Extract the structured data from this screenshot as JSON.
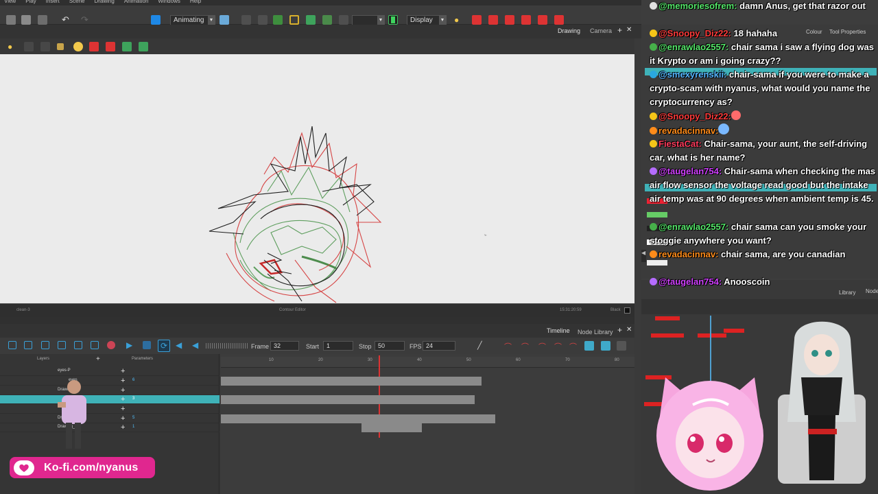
{
  "menu": [
    "View",
    "Play",
    "Insert",
    "Scene",
    "Drawing",
    "Animation",
    "Windows",
    "Help"
  ],
  "toolbar": {
    "mode": "Animating",
    "display": "Display"
  },
  "viewport": {
    "tabs": [
      "Drawing",
      "Camera"
    ],
    "status_left": "clean-3",
    "status_center": "Contour Editor",
    "status_right_a": "15:31:20:59",
    "status_right_b": "Black"
  },
  "timeline": {
    "tabs": [
      "Timeline",
      "Node Library"
    ],
    "frame_label": "Frame",
    "frame_value": "32",
    "start_label": "Start",
    "start_value": "1",
    "stop_label": "Stop",
    "stop_value": "50",
    "fps_label": "FPS",
    "fps_value": "24",
    "layers_header": "Layers",
    "params_header": "Parameters",
    "ruler": [
      "10",
      "20",
      "30",
      "40",
      "50",
      "60",
      "70",
      "80"
    ],
    "layers": [
      {
        "name": "eyes-P",
        "num": ""
      },
      {
        "name": "eyes",
        "num": "6"
      },
      {
        "name": "Drawing",
        "num": ""
      },
      {
        "name": "",
        "num": "3"
      },
      {
        "name": "",
        "num": ""
      },
      {
        "name": "Drawing_2",
        "num": "5"
      },
      {
        "name": "Drawing_3",
        "num": "1"
      }
    ]
  },
  "kofi": {
    "text": "Ko-fi.com/nyanus"
  },
  "chat": [
    {
      "user": "@memoriesofrem:",
      "text": " damn Anus, get that razor out",
      "color": "#55e86a"
    },
    {
      "user": "@Snoopy_Diz22:",
      "text": " 18 hahaha",
      "color": "#ff3b3b"
    },
    {
      "user": "@enrawlao2557:",
      "text": " chair sama i saw a flying dog was it Krypto or am i going crazy??",
      "color": "#55e86a"
    },
    {
      "user": "@smexyrenskii:",
      "text": " chair-sama if you were to make a crypto-scam with nyanus, what would you name the cryptocurrency as?",
      "color": "#55b4ff"
    },
    {
      "user": "@Snoopy_Diz22:",
      "text": "",
      "color": "#ff3b3b"
    },
    {
      "user": "revadacinnav:",
      "text": "",
      "color": "#ff8c1a"
    },
    {
      "user": "FiestaCat:",
      "text": " Chair-sama, your aunt, the self-driving car, what is her name?",
      "color": "#ff3b5c"
    },
    {
      "user": "@taugelan754:",
      "text": " Chair-sama when checking the mas air flow sensor the voltage read good but the intake air temp was at 90 degrees when ambient temp is 45.",
      "color": "#d040ff"
    },
    {
      "user": "@enrawlao2557:",
      "text": " chair sama can you smoke your stoggie anywhere you want?",
      "color": "#55e86a"
    },
    {
      "user": "revadacinnav:",
      "text": " chair sama, are you canadian",
      "color": "#ff8c1a"
    },
    {
      "user": "@taugelan754:",
      "text": " Anooscoin",
      "color": "#d040ff"
    }
  ],
  "right_panel": {
    "tabs": [
      "Colour",
      "Tool Properties"
    ],
    "library_tab": "Library",
    "node_tab": "Node"
  }
}
